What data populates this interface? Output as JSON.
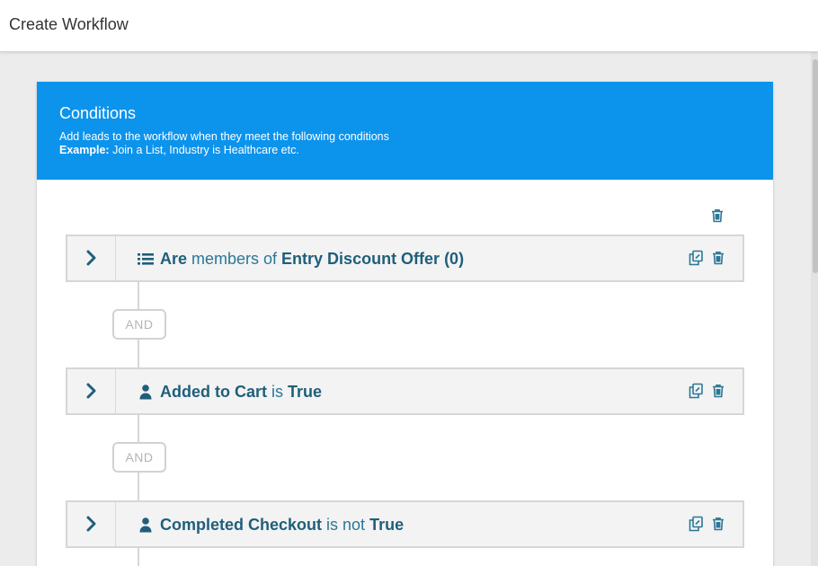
{
  "topbar": {
    "title": "Create Workflow"
  },
  "card": {
    "title": "Conditions",
    "description": "Add leads to the workflow when they meet the following conditions",
    "example_label": "Example:",
    "example_text": " Join a List, Industry is Healthcare etc."
  },
  "group": {
    "delete_icon": "trash-icon"
  },
  "connectors": [
    {
      "label": "AND"
    },
    {
      "label": "AND"
    }
  ],
  "conditions": [
    {
      "type_icon": "list-icon",
      "subject": "Are",
      "operator": " members of ",
      "value": "Entry Discount Offer (0)"
    },
    {
      "type_icon": "user-icon",
      "subject": "Added to Cart",
      "operator": " is ",
      "value": "True"
    },
    {
      "type_icon": "user-icon",
      "subject": "Completed Checkout",
      "operator": " is not ",
      "value": "True"
    }
  ],
  "colors": {
    "header": "#0c93ec",
    "condition_text": "#1f5f7b",
    "row_background": "#f3f3f3"
  },
  "row_actions": {
    "copy_icon": "copy-icon",
    "delete_icon": "trash-icon",
    "expand_icon": "chevron-right-icon"
  }
}
